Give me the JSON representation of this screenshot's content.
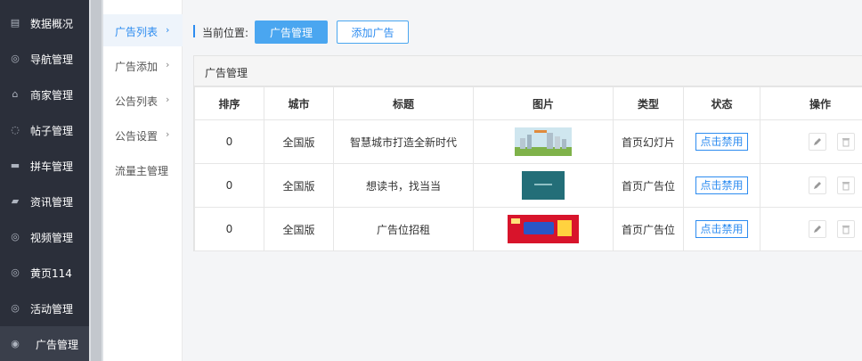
{
  "sidebar": {
    "items": [
      {
        "label": "数据概况",
        "icon": "newspaper-icon",
        "glyph": "▤"
      },
      {
        "label": "导航管理",
        "icon": "compass-icon",
        "glyph": "◎"
      },
      {
        "label": "商家管理",
        "icon": "bank-icon",
        "glyph": "⌂"
      },
      {
        "label": "帖子管理",
        "icon": "chat-bubble-icon",
        "glyph": "◌"
      },
      {
        "label": "拼车管理",
        "icon": "car-icon",
        "glyph": "▬"
      },
      {
        "label": "资讯管理",
        "icon": "book-icon",
        "glyph": "▰"
      },
      {
        "label": "视频管理",
        "icon": "compass-icon",
        "glyph": "◎"
      },
      {
        "label": "黄页114",
        "icon": "compass-icon",
        "glyph": "◎"
      },
      {
        "label": "活动管理",
        "icon": "compass-icon",
        "glyph": "◎"
      },
      {
        "label": "广告管理",
        "icon": "lifebuoy-icon",
        "glyph": "◉"
      }
    ],
    "active_index": 9
  },
  "subnav": {
    "items": [
      {
        "label": "广告列表",
        "chevron": "›"
      },
      {
        "label": "广告添加",
        "chevron": "›"
      },
      {
        "label": "公告列表",
        "chevron": "›"
      },
      {
        "label": "公告设置",
        "chevron": "›"
      },
      {
        "label": "流量主管理",
        "chevron": ""
      }
    ],
    "active_index": 0
  },
  "breadcrumb": {
    "label": "当前位置:",
    "current_button": "广告管理",
    "add_button": "添加广告"
  },
  "panel": {
    "title": "广告管理",
    "columns": [
      "排序",
      "城市",
      "标题",
      "图片",
      "类型",
      "状态",
      "操作"
    ],
    "rows": [
      {
        "order": "0",
        "city": "全国版",
        "title": "智慧城市打造全新时代",
        "image": "city-skyline-banner",
        "type": "首页幻灯片",
        "status": "点击禁用"
      },
      {
        "order": "0",
        "city": "全国版",
        "title": "想读书，找当当",
        "image": "teal-book-banner",
        "type": "首页广告位",
        "status": "点击禁用"
      },
      {
        "order": "0",
        "city": "全国版",
        "title": "广告位招租",
        "image": "red-ad-rental-banner",
        "type": "首页广告位",
        "status": "点击禁用"
      }
    ]
  },
  "colors": {
    "sidebar_bg": "#2b2f3a",
    "accent": "#2d8cf0",
    "primary_button": "#4aa6f0"
  }
}
